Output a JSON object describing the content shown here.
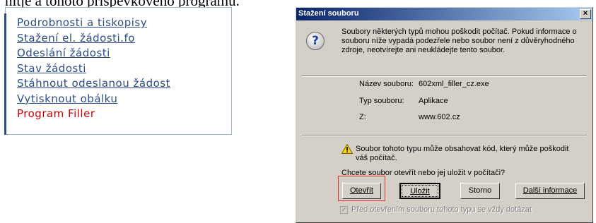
{
  "background_text": "nitje a tohoto příspěvkového programu.",
  "menu": {
    "items": [
      {
        "label": "Podrobnosti a tiskopisy"
      },
      {
        "label": "Stažení el. žádosti.fo"
      },
      {
        "label": "Odeslání žádosti"
      },
      {
        "label": "Stav žádosti"
      },
      {
        "label": "Stáhnout odeslanou žádost"
      },
      {
        "label": "Vytisknout obálku"
      },
      {
        "label": "Program Filler"
      }
    ],
    "link_color": "#2c4d8a",
    "active_color": "#cc0000"
  },
  "dialog": {
    "title": "Stažení souboru",
    "close_glyph": "×",
    "warning_text": "Soubory některých typů mohou poškodit počítač. Pokud informace o souboru níže vypadá podezřele nebo soubor není z důvěryhodného zdroje, neotvírejte ani neukládejte tento soubor.",
    "file": {
      "name_label": "Název souboru:",
      "name_value": "602xml_filler_cz.exe",
      "type_label": "Typ souboru:",
      "type_value": "Aplikace",
      "from_label": "Z:",
      "from_value": "www.602.cz"
    },
    "danger_text": "Soubor tohoto typu může obsahovat kód, který může poškodit váš počítač.",
    "question": "Chcete soubor otevřít nebo jej uložit v počítači?",
    "buttons": {
      "open": "Otevřít",
      "save": "Uložit",
      "cancel": "Storno",
      "more_info": "Další informace"
    },
    "checkbox_label": "Před otevřením souboru tohoto typu se vždy dotázat",
    "checkbox_checked": true,
    "icons": [
      "question-icon",
      "warning-icon",
      "close-icon"
    ],
    "highlight_color": "#e03030"
  }
}
